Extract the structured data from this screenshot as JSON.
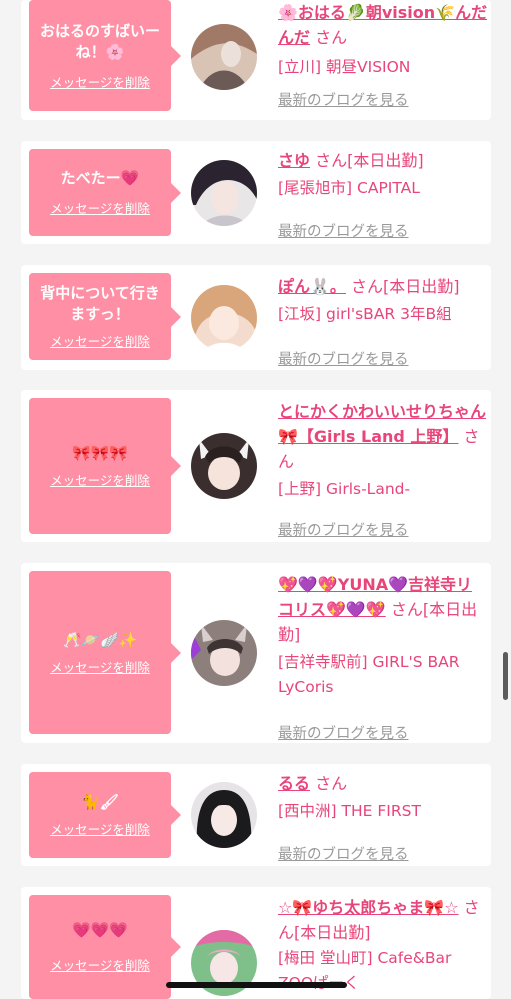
{
  "delete_label": "メッセージを削除",
  "blog_label": "最新のブログを見る",
  "san_label": "さん",
  "attendance_label": "[本日出勤]",
  "colors": {
    "bubble": "#ff8fa5",
    "name": "#e8457a",
    "link": "#9a9a9a"
  },
  "cards": [
    {
      "message": "おはるのすばいーね！🌸",
      "name": "🌸おはる🥬朝vision🌾んだんだ",
      "store": "[立川] 朝昼VISION",
      "on_duty": false
    },
    {
      "message": "たべたー💗",
      "name": "さゆ",
      "store": "[尾張旭市] CAPITAL",
      "on_duty": true
    },
    {
      "message": "背中について行きますっ！",
      "name": "ぽん🐰。",
      "store": "[江坂] girl'sBAR 3年B組",
      "on_duty": true
    },
    {
      "message": "🎀🎀🎀",
      "name": "とにかくかわいいせりちゃん🎀【Girls Land 上野】",
      "store": "[上野] Girls-Land-",
      "on_duty": false
    },
    {
      "message": "🥂🪐🪽✨",
      "name": "💖💜💖YUNA💜吉祥寺リコリス💖💜💖",
      "store": "[吉祥寺駅前] GIRL'S BAR LyCoris",
      "on_duty": true
    },
    {
      "message": "🐈🖌",
      "name": "るる",
      "store": "[西中洲] THE FIRST",
      "on_duty": false
    },
    {
      "message": "💗💗💗",
      "name": "☆🎀ゆち太郎ちゃま🎀☆",
      "store": "[梅田 堂山町] Cafe&Bar ZOOぱーく",
      "on_duty": true
    }
  ]
}
